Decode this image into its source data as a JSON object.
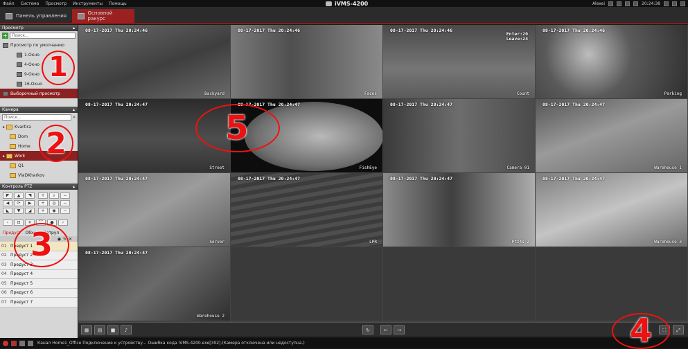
{
  "menu": [
    "Файл",
    "Система",
    "Просмотр",
    "Инструменты",
    "Помощь"
  ],
  "app_title": "iVMS-4200",
  "top_right": {
    "user": "Alexei",
    "time": "20:24:38"
  },
  "tabs": [
    {
      "label": "Панель управления"
    },
    {
      "label": "Основной ракурс"
    }
  ],
  "sidebar": {
    "view_header": "Просмотр",
    "view_search_placeholder": "Поиск...",
    "view_items": [
      {
        "label": "Просмотр по умолчанию"
      },
      {
        "label": "1-Окно"
      },
      {
        "label": "4-Окно"
      },
      {
        "label": "9-Окно"
      },
      {
        "label": "16-Окно"
      },
      {
        "label": "Выборочный просмотр"
      }
    ],
    "camera_header": "Камера",
    "camera_search_placeholder": "Поиск...",
    "camera_items": [
      {
        "label": "Kvartira"
      },
      {
        "label": "Dom"
      },
      {
        "label": "Home"
      },
      {
        "label": "Work"
      },
      {
        "label": "Q1"
      },
      {
        "label": "VlaDKharkov"
      }
    ],
    "ptz_header": "Контроль PTZ",
    "preset_tabs": [
      "Предуст",
      "Обход",
      "Патрул"
    ],
    "presets": [
      {
        "num": "01",
        "label": "Предуст 1"
      },
      {
        "num": "02",
        "label": "Предуст 2"
      },
      {
        "num": "03",
        "label": "Предуст 3"
      },
      {
        "num": "04",
        "label": "Предуст 4"
      },
      {
        "num": "05",
        "label": "Предуст 5"
      },
      {
        "num": "06",
        "label": "Предуст 6"
      },
      {
        "num": "07",
        "label": "Предуст 7"
      }
    ]
  },
  "cameras": [
    {
      "ts": "08-17-2017 Thu 20:24:46",
      "name": "Backyard"
    },
    {
      "ts": "08-17-2017 Thu 20:24:46",
      "name": "Faces"
    },
    {
      "ts": "08-17-2017 Thu 20:24:46",
      "name": "Count",
      "extra1": "Enter:20",
      "extra2": "Leave:24"
    },
    {
      "ts": "08-17-2017 Thu 20:24:46",
      "name": "Parking"
    },
    {
      "ts": "08-17-2017 Thu 20:24:47",
      "name": "Street"
    },
    {
      "ts": "08-17-2017 Thu 20:24:47",
      "name": "FishEye"
    },
    {
      "ts": "08-17-2017 Thu 20:24:47",
      "name": "Camera 01"
    },
    {
      "ts": "08-17-2017 Thu 20:24:47",
      "name": "Warehouse 1"
    },
    {
      "ts": "08-17-2017 Thu 20:24:47",
      "name": "Server"
    },
    {
      "ts": "08-17-2017 Thu 20:24:47",
      "name": "LPR"
    },
    {
      "ts": "08-17-2017 Thu 20:24:47",
      "name": "Ptz4s 2"
    },
    {
      "ts": "08-17-2017 Thu 20:24:47",
      "name": "Warehouse 3"
    },
    {
      "ts": "08-17-2017 Thu 20:24:47",
      "name": "Warehouse 2"
    }
  ],
  "statusbar": {
    "text": "Канал Home1_Office Подключение к устройству... Ошибка кода iVMS-4200.exe[302].(Камера отключена или недоступна.)"
  },
  "annotations": [
    "1",
    "2",
    "3",
    "4",
    "5"
  ]
}
